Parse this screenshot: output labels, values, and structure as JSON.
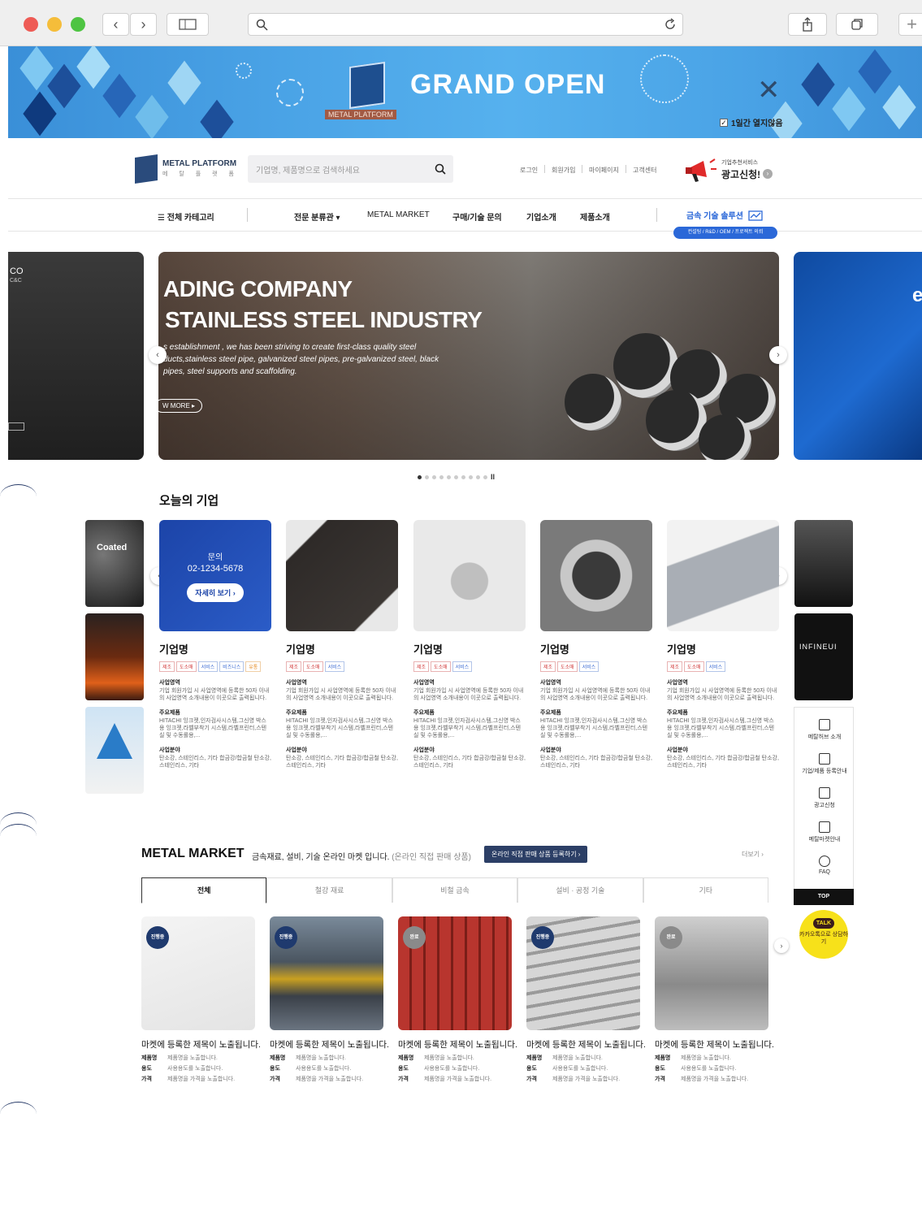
{
  "browser": {
    "back": "‹",
    "forward": "›"
  },
  "banner": {
    "title": "GRAND OPEN",
    "logo_text": "METAL PLATFORM",
    "checkbox_label": "1일간 열지않음"
  },
  "header": {
    "logo_title": "METAL PLATFORM",
    "logo_sub": "메 탈 플 랫 폼",
    "search_placeholder": "기업명, 제품명으로 검색하세요",
    "util_links": [
      "로그인",
      "회원가입",
      "마이페이지",
      "고객센터"
    ],
    "ad_small": "기업추천서비스",
    "ad_big": "광고신청!"
  },
  "nav": {
    "all_categories": "☰ 전체 카테고리",
    "items": [
      "전문 분류관 ▾",
      "METAL MARKET",
      "구매/기술 문의",
      "기업소개",
      "제품소개"
    ],
    "solution": "금속 기술 솔루션",
    "solution_pill": "컨설팅 / R&D / OEM / 프로젝트 의뢰"
  },
  "hero": {
    "line1": "ADING COMPANY",
    "line2": "STAINLESS STEEL INDUSTRY",
    "paragraph": "s establishment , we has been striving to create first-class quality steel ducts,stainless steel pipe, galvanized steel pipes, pre-galvanized steel, black pipes, steel supports and scaffolding.",
    "more": "W MORE ▸",
    "left_peek": "CO",
    "left_peek_sub": "C&C",
    "right_peek": "e",
    "total_slides": 10,
    "active_slide": 1,
    "pause": "II"
  },
  "today": {
    "title": "오늘의 기업",
    "left_thumb_label": "Coated",
    "right_thumb_label": "INFINEUI",
    "contact": {
      "label": "문의",
      "phone": "02-1234-5678",
      "button": "자세히 보기 ›"
    },
    "cards": [
      {
        "name": "기업명",
        "tags": [
          [
            "제조",
            "red"
          ],
          [
            "도소매",
            "red"
          ],
          [
            "서비스",
            "blue"
          ],
          [
            "비즈니스",
            "blue"
          ],
          [
            "유통",
            "orange"
          ]
        ]
      },
      {
        "name": "기업명",
        "tags": [
          [
            "제조",
            "red"
          ],
          [
            "도소매",
            "red"
          ],
          [
            "서비스",
            "blue"
          ]
        ]
      },
      {
        "name": "기업명",
        "tags": [
          [
            "제조",
            "red"
          ],
          [
            "도소매",
            "red"
          ],
          [
            "서비스",
            "blue"
          ]
        ]
      },
      {
        "name": "기업명",
        "tags": [
          [
            "제조",
            "red"
          ],
          [
            "도소매",
            "red"
          ],
          [
            "서비스",
            "blue"
          ]
        ]
      },
      {
        "name": "기업명",
        "tags": [
          [
            "제조",
            "red"
          ],
          [
            "도소매",
            "red"
          ],
          [
            "서비스",
            "blue"
          ]
        ]
      }
    ],
    "field_h": "사업영역",
    "field_t": "기업 회원가입 시 사업영역에 등록한 50자 이내의 사업영역 소개내용이 이곳으로 출력됩니다.",
    "product_h": "주요제품",
    "product_t": "HITACHI 잉크젯,인자검사시스템,그신영 박스용 잉크젯,라벨부착기 시스템,라벨프린터,스텐실 및 수동롤용,...",
    "biz_h": "사업분야",
    "biz_t": "탄소강, 스테인리스, 기타 합금강/합금철 탄소강, 스테인리스, 기타"
  },
  "quick_menu": {
    "items": [
      "메탈허브 소개",
      "기업/제품 등록안내",
      "광고신청",
      "메탈마켓안내",
      "FAQ"
    ],
    "top": "TOP",
    "kakao_bubble": "TALK",
    "kakao_text": "카카오톡으로 상담하기"
  },
  "market": {
    "title": "METAL MARKET",
    "desc": "금속재료, 설비, 기술 온라인 마켓 입니다.",
    "desc_sub": "(온라인 직접 판매 상품)",
    "register": "온라인 직접 판매 상품 등록하기 ›",
    "more": "더보기 ›",
    "tabs": [
      "전체",
      "철강 재료",
      "비철 금속",
      "설비 · 공정 기술",
      "기타"
    ],
    "products": [
      {
        "badge": "진행중",
        "badge_color": "#1f3a6e"
      },
      {
        "badge": "진행중",
        "badge_color": "#1f3a6e"
      },
      {
        "badge": "완료",
        "badge_color": "#8a8a8a"
      },
      {
        "badge": "진행중",
        "badge_color": "#1f3a6e"
      },
      {
        "badge": "완료",
        "badge_color": "#8a8a8a"
      }
    ],
    "product_title": "마켓에 등록한 제목이 노출됩니다.",
    "k_name": "제품명",
    "v_name": "제품명을 노출합니다.",
    "k_use": "용도",
    "v_use": "사용용도를 노출합니다.",
    "k_price": "가격",
    "v_price": "제품명을 가격을 노출합니다."
  },
  "colors": {
    "accent": "#2b68d8",
    "dark_navy": "#2c3f66",
    "kakao": "#f7e11a"
  }
}
